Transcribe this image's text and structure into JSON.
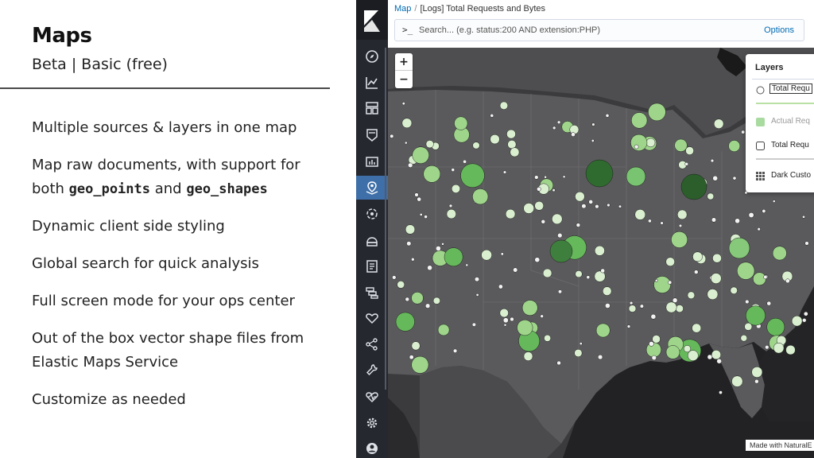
{
  "slide": {
    "title": "Maps",
    "subtitle": "Beta | Basic (free)",
    "bullets": {
      "b1": "Multiple sources & layers in one map",
      "b2_line1": "Map raw documents, with support for",
      "b2_line2_pre": "both",
      "b2_code1": "geo_points",
      "b2_and": "and",
      "b2_code2": "geo_shapes",
      "b3": "Dynamic client side styling",
      "b4": "Global search for quick analysis",
      "b5": "Full screen mode for your ops center",
      "b6_line1": "Out of the box vector shape files from",
      "b6_line2": "Elastic Maps Service",
      "b7": "Customize as needed"
    }
  },
  "kibana": {
    "breadcrumb": {
      "root": "Map",
      "separator": "/",
      "current": "[Logs] Total Requests and Bytes"
    },
    "search": {
      "prompt": ">_",
      "placeholder": "Search... (e.g. status:200 AND extension:PHP)",
      "options_label": "Options"
    },
    "zoom": {
      "in": "+",
      "out": "−"
    },
    "layers_panel": {
      "title": "Layers",
      "items": [
        {
          "label": "Total Requ",
          "control": "radio",
          "state": "highlighted",
          "bar_color": "#b9e0a5"
        },
        {
          "label": "Actual Req",
          "control": "swatch",
          "state": "faded",
          "swatch_color": "#a9dba0"
        },
        {
          "label": "Total Requ",
          "control": "checkbox",
          "state": "normal",
          "bar_color": "#cccccc"
        },
        {
          "label": "Dark Custo",
          "control": "grid-icon",
          "state": "normal"
        }
      ]
    },
    "attribution": "Made with NaturalE",
    "nav_icons": [
      "compass-icon",
      "visualize-icon",
      "dashboard-icon",
      "canvas-icon",
      "timelion-icon",
      "maps-icon",
      "ml-icon",
      "infrastructure-icon",
      "logs-icon",
      "apm-icon",
      "uptime-icon",
      "graph-icon",
      "devtools-icon",
      "monitoring-icon",
      "management-icon",
      "user-icon"
    ],
    "colors": {
      "nav_bg": "#25282f",
      "nav_active": "#3e6fa8",
      "map_bg": "#3a3a3c",
      "land": "#5b5b5d",
      "water": "#1f1f21",
      "link": "#006bb4"
    }
  }
}
